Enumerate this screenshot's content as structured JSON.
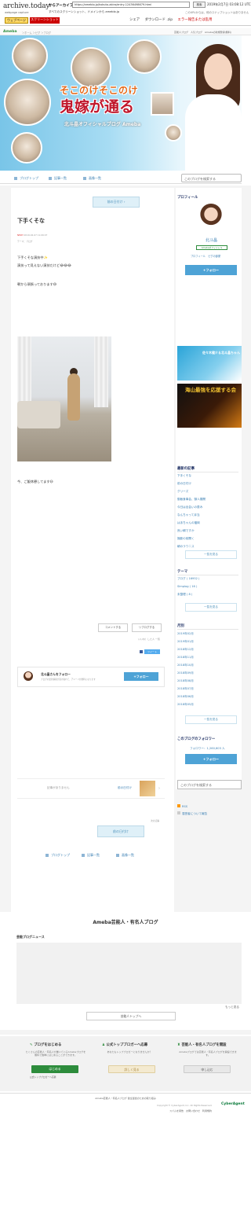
{
  "archive": {
    "logo": "archive.today",
    "logo_sub": "webpage capture",
    "label": "からアーカイブ",
    "url": "https://ameblo.jp/hokuto-akira/entry-12436498679.html",
    "search_btn": "検索",
    "date": "2019年2月7日 03:08:12 UTC",
    "notice": "すべてのスクリーンショット、ドメインから ameblo.jp",
    "notice2": "このURLからは、他のスナップショットはありません",
    "tab_web": "ウェブページ",
    "tab_shot": "スクリーンショット",
    "actions": [
      "シェア",
      "ダウンロード .zip",
      "エラー報告または乱用"
    ]
  },
  "ameba": {
    "logo": "Ameba",
    "breadcrumb": "＞ホーム ＞ピグ ＞ブログ",
    "header_right": "芸能人ブログ　人気ブログ　Amebaの新規登録(無料)"
  },
  "banner": {
    "title_top": "そこのけそこのけ",
    "title_main": "鬼嫁が通る",
    "subtitle": "北斗晶オフィシャルブログ Ameba"
  },
  "nav": {
    "items": [
      "ブログトップ",
      "記事一覧",
      "画像一覧"
    ],
    "search_placeholder": "このブログを検索する"
  },
  "post": {
    "next_top": "前の日付け",
    "title": "下手くそな",
    "new_badge": "NEW!",
    "date": "2019-02-07 11:06:07",
    "theme": "テーマ：ブログ",
    "lines": [
      "下手くそな演技中✨",
      "演技って見えない演技だけど😂😂😂",
      "",
      "朝から頑張っております😅"
    ],
    "closing": "今、ご飯休憩してます😃",
    "comment_btn": "コメントする",
    "reblog_btn": "リブログする",
    "like_note": "いいね！した人 一覧",
    "tweet": "ツイート",
    "follow_name": "北斗晶さんをフォロー",
    "follow_desc": "ブログの更新情報が受け取れて、アメーバが便利になります",
    "follow_btn": "+フォロー",
    "prev_none": "記事がありません",
    "prev_label": "前の日付け",
    "count_label": "次の記事",
    "bottom_btn": "前の日付け"
  },
  "side": {
    "profile_h": "プロフィール",
    "name": "北斗晶",
    "badge": "Amebaオフィシャル",
    "prof_links": "プロフィール　ピグの部屋",
    "follow": "+フォロー",
    "ad1": "佐々木健介＆北斗晶ちゃん",
    "ad2": "海山最強を応援する会",
    "recent_h": "最新の記事",
    "recent": [
      "下手くそな",
      "前の日付け",
      "グリーズ",
      "御飯食事会、御人展開",
      "今日は出会いの恵み",
      "なんちゃって弁当",
      "はあちゃんの福岡",
      "良い朝ですか",
      "撮影の前開く",
      "朝のラワニス"
    ],
    "more1": "一覧を見る",
    "theme_h": "テーマ",
    "themes": [
      "ブログ ( 16952 )",
      "Simplog ( 16 )",
      "未整理 ( 8 )"
    ],
    "more2": "一覧を見る",
    "archive_h": "月別",
    "archives": [
      "2019年02月",
      "2019年01月",
      "2018年12月",
      "2018年11月",
      "2018年10月",
      "2018年09月",
      "2018年08月",
      "2018年07月",
      "2018年06月",
      "2018年05月"
    ],
    "more3": "一覧を見る",
    "followers_h": "このブログのフォロワー",
    "followers": "フォロワー：1,260,603 人",
    "follow2": "+フォロー",
    "search2": "このブログを検索する",
    "rss": "RSS",
    "report": "運営者について報告"
  },
  "bottomnav": {
    "items": [
      "ブログトップ",
      "記事一覧",
      "画像一覧"
    ]
  },
  "footer": {
    "section_h": "Ameba芸能人・有名人ブログ",
    "news_h": "芸能ブログニュース",
    "more": "もっと見る",
    "top_btn": "芸能人トップへ",
    "cta": [
      {
        "title": "ブログをはじめる",
        "desc": "たくさんの芸能人・有名人が書いているAmebaブログを無料で簡単にはじめることができます。",
        "btn": "はじめる",
        "note": "公式トップブロガーへ応募"
      },
      {
        "title": "公式トップブロガーへ応募",
        "desc": "あなたもトップブロガーになりませんか？",
        "btn": "詳しく見る",
        "note": ""
      },
      {
        "title": "芸能人・有名人ブログを開設",
        "desc": "Amebaブログでは芸能人・有名人ブログを開設できます。",
        "btn": "申し込む",
        "note": ""
      }
    ],
    "sitenote": "Ameba芸能人・有名人ブログ 健全運営のための取り組み",
    "copyright": "Copyright © CyberAgent, Inc. All Rights Reserved.",
    "links": "スパムを報告　お問い合わせ　利用規約",
    "brand": "CyberAgent"
  }
}
